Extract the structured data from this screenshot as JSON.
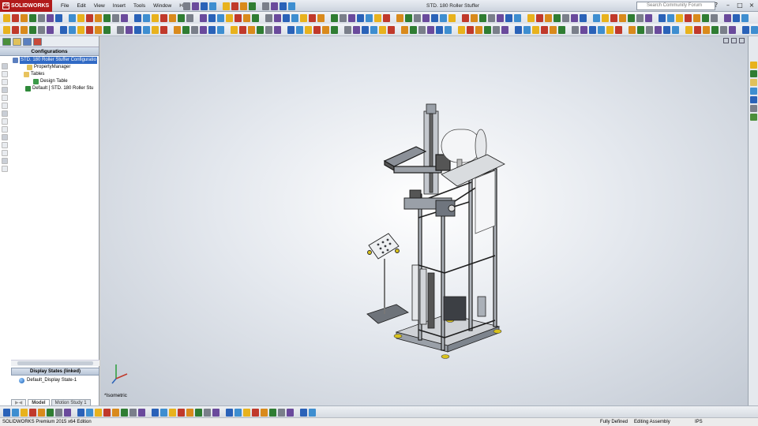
{
  "app": {
    "brand": "SOLIDWORKS",
    "brand_mark": "DS",
    "brand_color": "#b11a1a"
  },
  "menu": [
    "File",
    "Edit",
    "View",
    "Insert",
    "Tools",
    "Window",
    "Help"
  ],
  "document_title": "STD. 180 Roller Stuffer",
  "search": {
    "placeholder": "Search Community Forum"
  },
  "window_controls": [
    "?",
    "–",
    "□",
    "×"
  ],
  "config_manager": {
    "header": "Configurations",
    "tree": [
      {
        "label": "STD. 180 Roller Stuffer Configuratio",
        "selected": true,
        "icon": "assembly-config-icon"
      },
      {
        "label": "PropertyManager",
        "selected": false,
        "icon": "property-manager-icon"
      },
      {
        "label": "Tables",
        "selected": false,
        "icon": "tables-folder-icon"
      },
      {
        "label": "Design Table",
        "selected": false,
        "icon": "design-table-icon"
      },
      {
        "label": "Default [ STD. 180 Roller Stu",
        "selected": false,
        "icon": "checkmark-config-icon"
      }
    ]
  },
  "display_states": {
    "header": "Display States (linked)",
    "item": "Default_Display State-1"
  },
  "bottom_tabs": [
    "Model",
    "Motion Study 1"
  ],
  "viewport": {
    "view_name": "*Isometric"
  },
  "status": {
    "edition": "SOLIDWORKS Premium 2015 x64 Edition",
    "definition": "Fully Defined",
    "mode": "Editing Assembly",
    "units": "IPS"
  },
  "colors": {
    "accent": "#316ac5",
    "icon_colors": [
      "#e8b21d",
      "#2f7d32",
      "#2a62b8",
      "#c0392b",
      "#7a7f8a",
      "#3e8ed0",
      "#d98a1c",
      "#6a4a9c"
    ]
  }
}
